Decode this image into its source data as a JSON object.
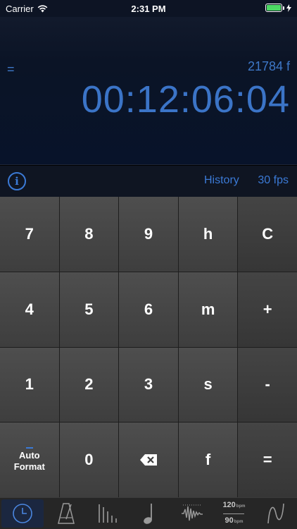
{
  "status_bar": {
    "carrier": "Carrier",
    "time": "2:31 PM"
  },
  "display": {
    "equals": "=",
    "frames": "21784 f",
    "timecode": "00:12:06:04"
  },
  "infobar": {
    "info_glyph": "i",
    "history": "History",
    "fps": "30 fps"
  },
  "keypad": {
    "k7": "7",
    "k8": "8",
    "k9": "9",
    "kh": "h",
    "kc": "C",
    "k4": "4",
    "k5": "5",
    "k6": "6",
    "km": "m",
    "kplus": "+",
    "k1": "1",
    "k2": "2",
    "k3": "3",
    "ks": "s",
    "kminus": "-",
    "auto_line1": "Auto",
    "auto_line2": "Format",
    "k0": "0",
    "kf": "f",
    "keq": "="
  },
  "tabbar": {
    "bpm_top": "120",
    "bpm_bottom": "90",
    "bpm_unit": "bpm"
  },
  "colors": {
    "accent": "#3b7ad6",
    "battery": "#4cd964"
  }
}
